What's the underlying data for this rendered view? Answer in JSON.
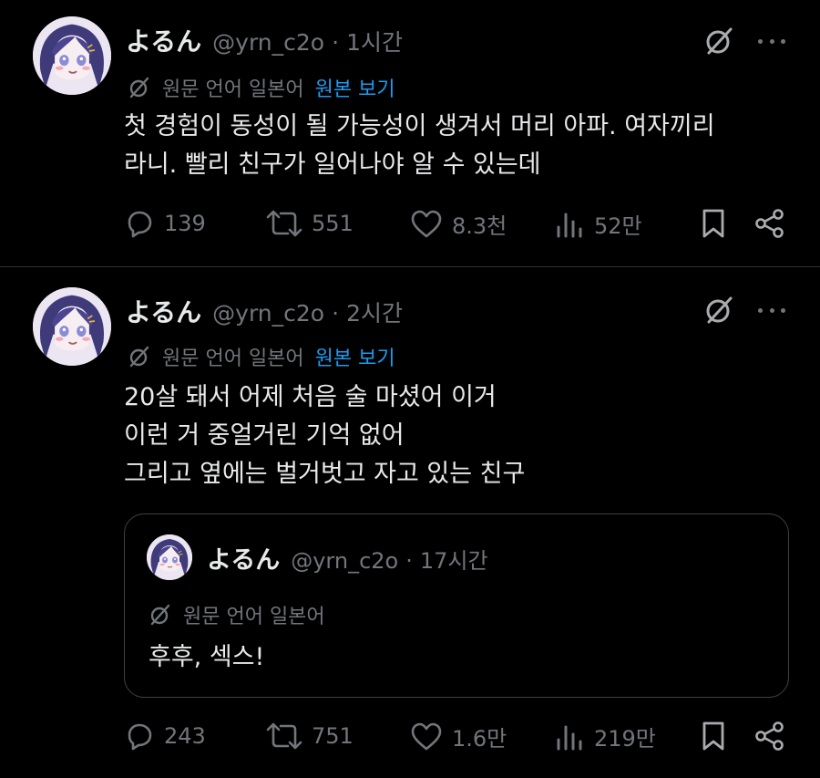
{
  "tweets": [
    {
      "display_name": "よるん",
      "handle": "@yrn_c2o",
      "separator": "·",
      "time": "1시간",
      "translation_label": "원문 언어 일본어",
      "translation_link": "원본 보기",
      "text_lines": [
        "첫 경험이 동성이 될 가능성이 생겨서 머리 아파. 여자끼리",
        "라니. 빨리 친구가 일어나야 알 수 있는데"
      ],
      "stats": {
        "replies": "139",
        "retweets": "551",
        "likes": "8.3천",
        "views": "52만"
      }
    },
    {
      "display_name": "よるん",
      "handle": "@yrn_c2o",
      "separator": "·",
      "time": "2시간",
      "translation_label": "원문 언어 일본어",
      "translation_link": "원본 보기",
      "text_lines": [
        "20살 돼서 어제 처음 술 마셨어 이거",
        "이런 거 중얼거린 기억 없어",
        "그리고 옆에는 벌거벗고 자고 있는 친구"
      ],
      "quote": {
        "display_name": "よるん",
        "handle": "@yrn_c2o",
        "separator": "·",
        "time": "17시간",
        "translation_label": "원문 언어 일본어",
        "text": "후후, 섹스!"
      },
      "stats": {
        "replies": "243",
        "retweets": "751",
        "likes": "1.6만",
        "views": "219만"
      }
    }
  ],
  "icons": {
    "grok": "grok-icon",
    "more": "more-icon",
    "translate": "translate-icon",
    "reply": "reply-icon",
    "retweet": "retweet-icon",
    "like": "like-icon",
    "views": "views-icon",
    "bookmark": "bookmark-icon",
    "share": "share-icon"
  },
  "colors": {
    "background": "#000000",
    "text": "#e7e9ea",
    "muted": "#71767b",
    "link": "#1d9bf0",
    "border": "#2f3336"
  }
}
